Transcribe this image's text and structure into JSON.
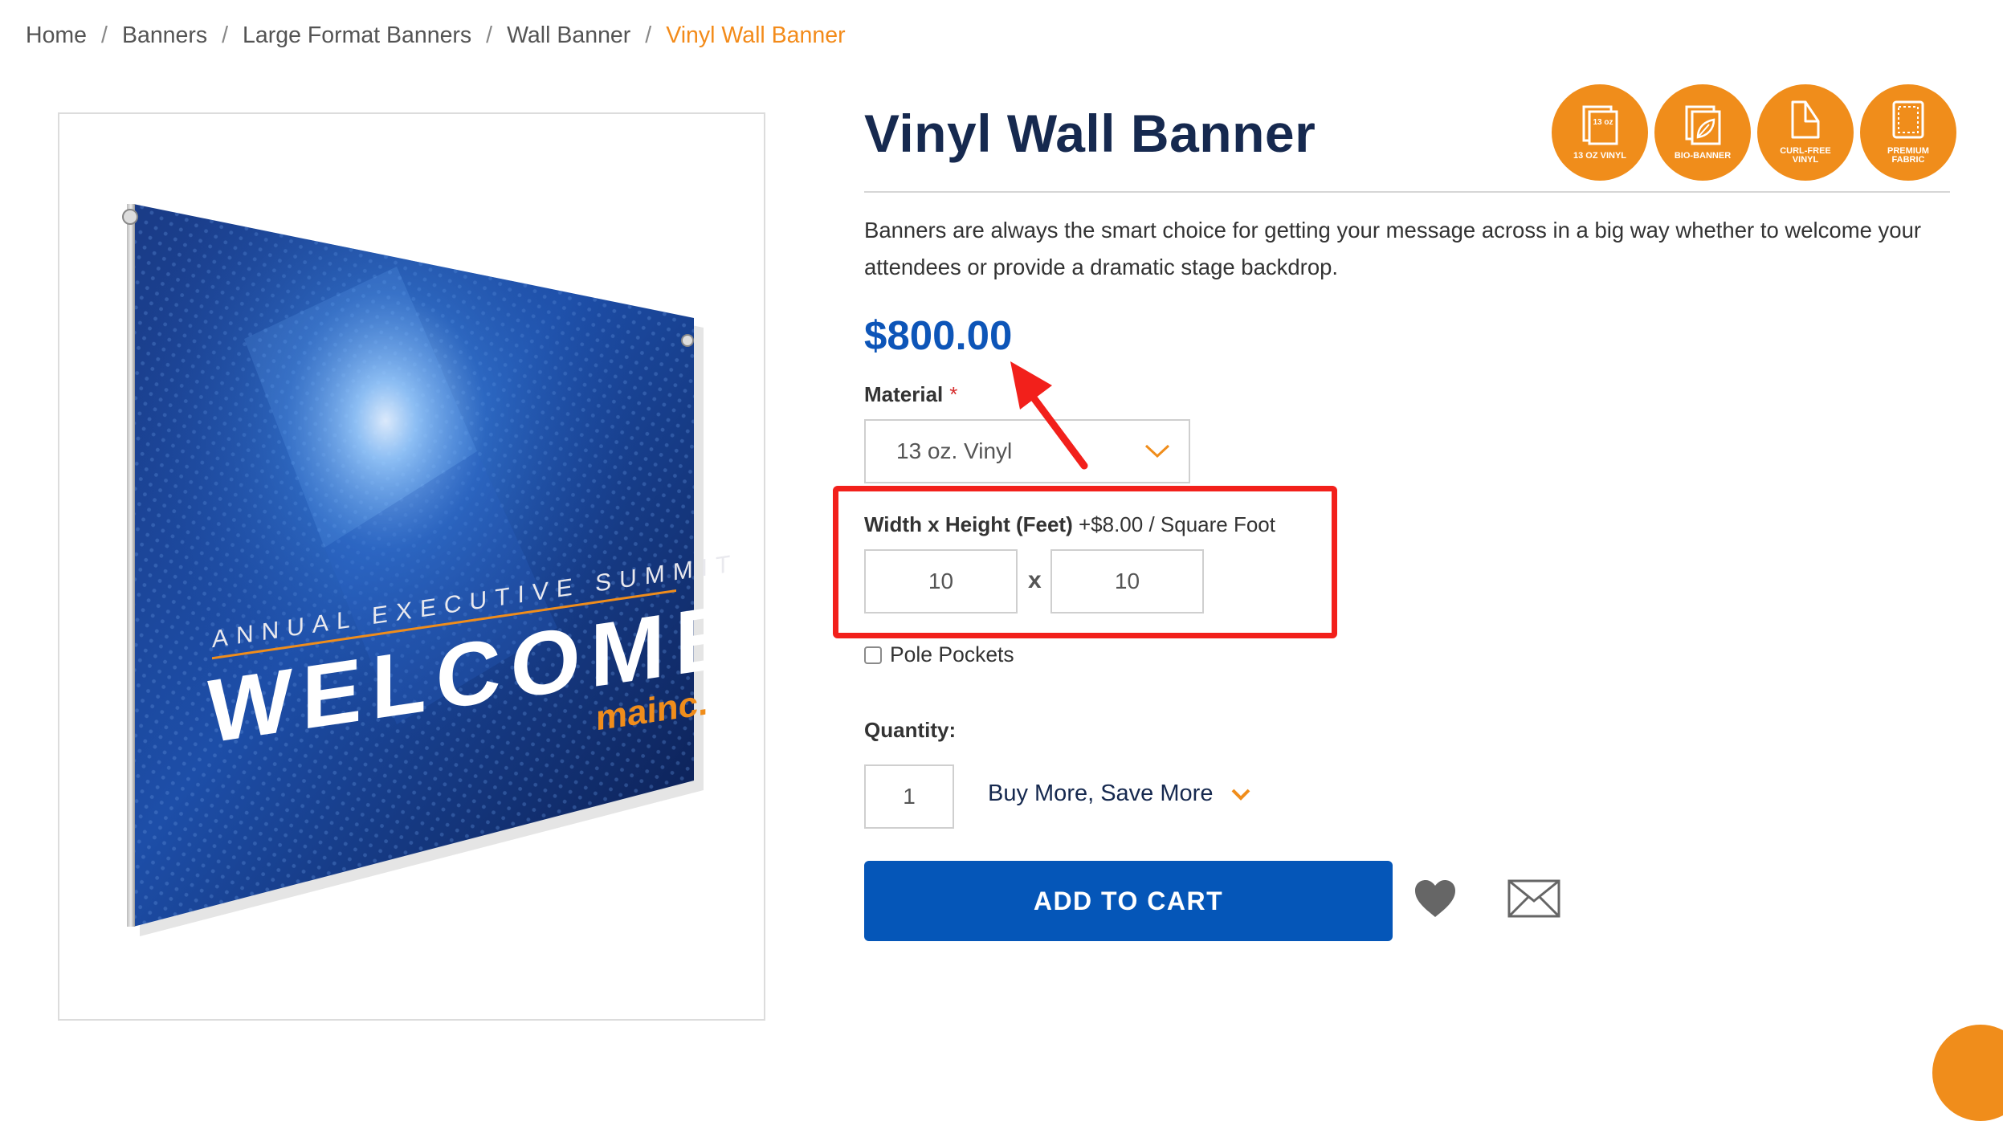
{
  "breadcrumb": {
    "items": [
      "Home",
      "Banners",
      "Large Format Banners",
      "Wall Banner"
    ],
    "current": "Vinyl Wall Banner",
    "separator": "/"
  },
  "product": {
    "title": "Vinyl Wall Banner",
    "description": "Banners are always the smart choice for getting your message across in a big way whether to welcome your attendees or provide a dramatic stage backdrop.",
    "price": "$800.00",
    "image": {
      "subtitle": "ANNUAL EXECUTIVE SUMMIT",
      "headline": "WELCOME",
      "logo": "mainc."
    }
  },
  "badges": [
    {
      "icon": "vinyl-sheet-icon",
      "overlay": "13 oz",
      "label": "13 OZ VINYL"
    },
    {
      "icon": "bio-leaf-icon",
      "label": "BIO-BANNER"
    },
    {
      "icon": "curl-free-icon",
      "label": "CURL-FREE VINYL"
    },
    {
      "icon": "fabric-icon",
      "label": "PREMIUM FABRIC"
    }
  ],
  "material": {
    "label": "Material",
    "required_mark": "*",
    "selected": "13 oz. Vinyl"
  },
  "dimensions": {
    "label": "Width x Height (Feet)",
    "price_note": "+$8.00 / Square Foot",
    "width": "10",
    "height": "10",
    "separator": "x"
  },
  "pole_pockets": {
    "label": "Pole Pockets",
    "checked": false
  },
  "quantity": {
    "label": "Quantity:",
    "value": "1"
  },
  "buy_more": {
    "label": "Buy More, Save More"
  },
  "add_to_cart": {
    "label": "ADD TO CART"
  },
  "colors": {
    "accent_orange": "#f08d1b",
    "title_navy": "#16294f",
    "price_blue": "#0d55b8",
    "button_blue": "#0556b8",
    "annotation_red": "#f2201b"
  }
}
